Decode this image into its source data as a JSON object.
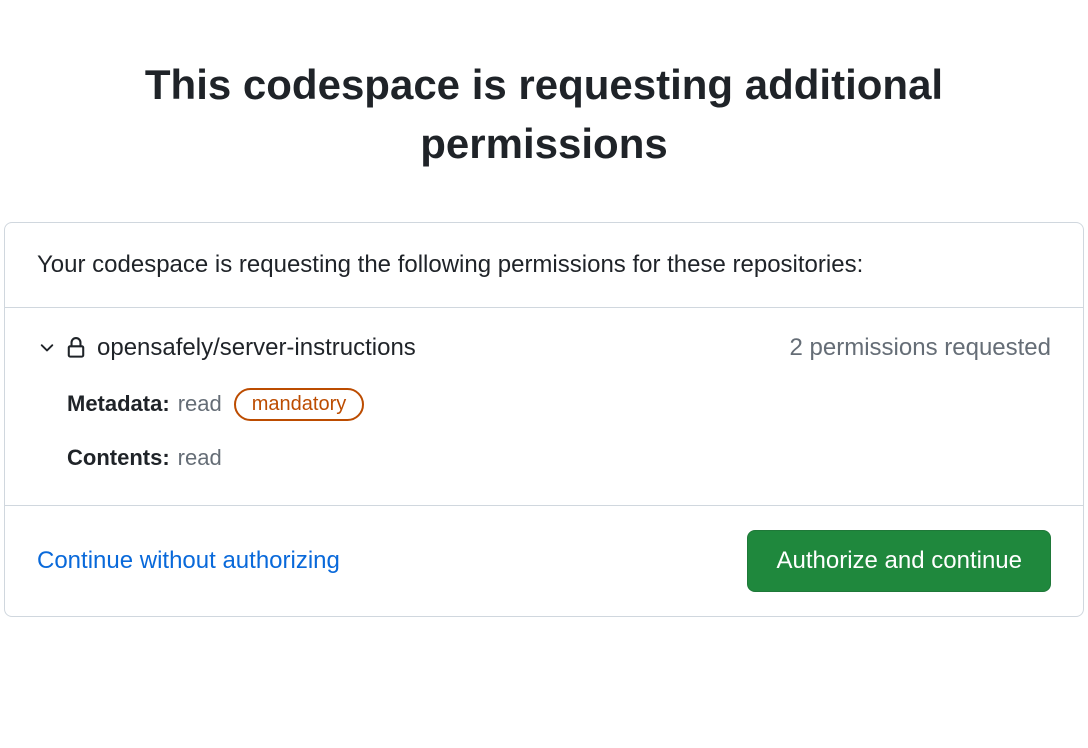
{
  "title": "This codespace is requesting additional permissions",
  "description": "Your codespace is requesting the following permissions for these repositories:",
  "repository": {
    "name": "opensafely/server-instructions",
    "permissions_count_text": "2 permissions requested",
    "permissions": [
      {
        "label": "Metadata:",
        "value": "read",
        "badge": "mandatory"
      },
      {
        "label": "Contents:",
        "value": "read",
        "badge": null
      }
    ]
  },
  "actions": {
    "secondary": "Continue without authorizing",
    "primary": "Authorize and continue"
  }
}
